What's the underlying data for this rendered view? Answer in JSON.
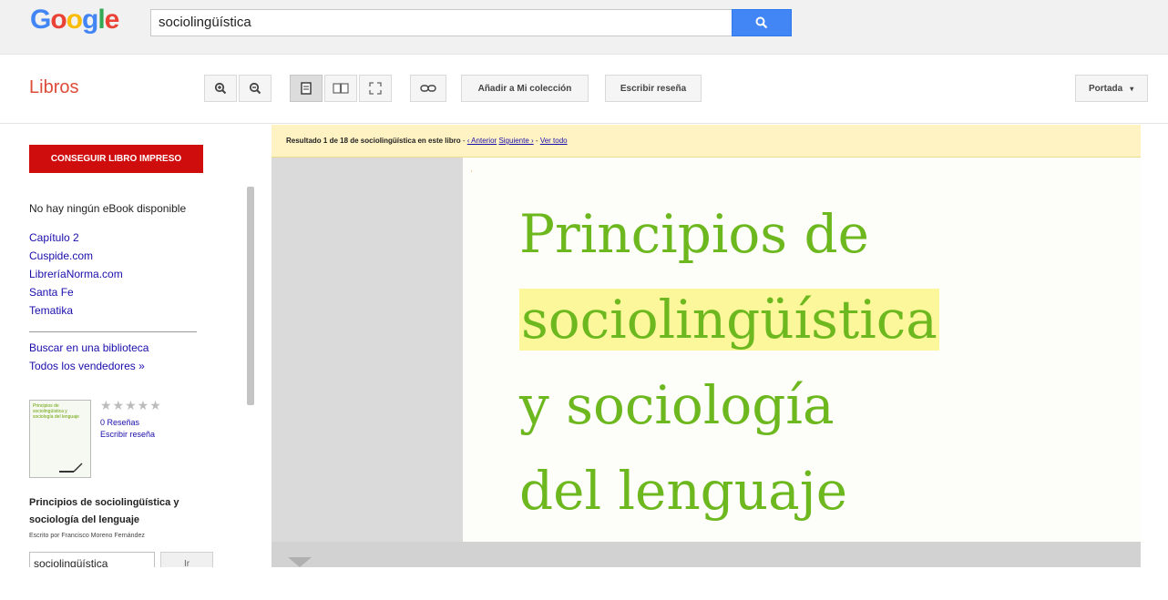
{
  "header": {
    "logo_parts": [
      "G",
      "o",
      "o",
      "g",
      "l",
      "e"
    ],
    "search_value": "sociolingüística",
    "search_icon": "search-icon"
  },
  "toolbar": {
    "title": "Libros",
    "zoom_in_icon": "zoom-in-icon",
    "zoom_out_icon": "zoom-out-icon",
    "single_page_icon": "single-page-icon",
    "two_page_icon": "two-page-icon",
    "fullscreen_icon": "fullscreen-icon",
    "link_icon": "link-icon",
    "add_collection": "Añadir a Mi colección",
    "write_review": "Escribir reseña",
    "view_select": "Portada"
  },
  "sidebar": {
    "buy_button": "CONSEGUIR LIBRO IMPRESO",
    "no_ebook": "No hay ningún eBook disponible",
    "vendors": [
      "Capítulo 2",
      "Cuspide.com",
      "LibreríaNorma.com",
      "Santa Fe",
      "Tematika"
    ],
    "library_link": "Buscar en una biblioteca",
    "all_sellers": "Todos los vendedores »",
    "stars": "★★★★★",
    "reviews_count": "0 Reseñas",
    "write_review_link": "Escribir reseña",
    "book_title": "Principios de sociolingüística y sociología del lenguaje",
    "author": "Escrito por Francisco Moreno Fernández",
    "inbook_search_value": "sociolingüística",
    "inbook_go": "Ir"
  },
  "result_bar": {
    "text": "Resultado 1 de 18 de sociolingüística en este libro",
    "prev_link": "‹ Anterior",
    "next_link": "Siguiente ›",
    "view_all": "Ver todo"
  },
  "page": {
    "line1": "Principios de",
    "line2": "sociolingüística",
    "line3": "y sociología",
    "line4": "del lenguaje"
  },
  "colors": {
    "brand_red": "#dd4b39",
    "button_red": "#d00d0d",
    "search_blue": "#4285f4",
    "title_green": "#6db81f",
    "highlight": "#fbf79a"
  }
}
